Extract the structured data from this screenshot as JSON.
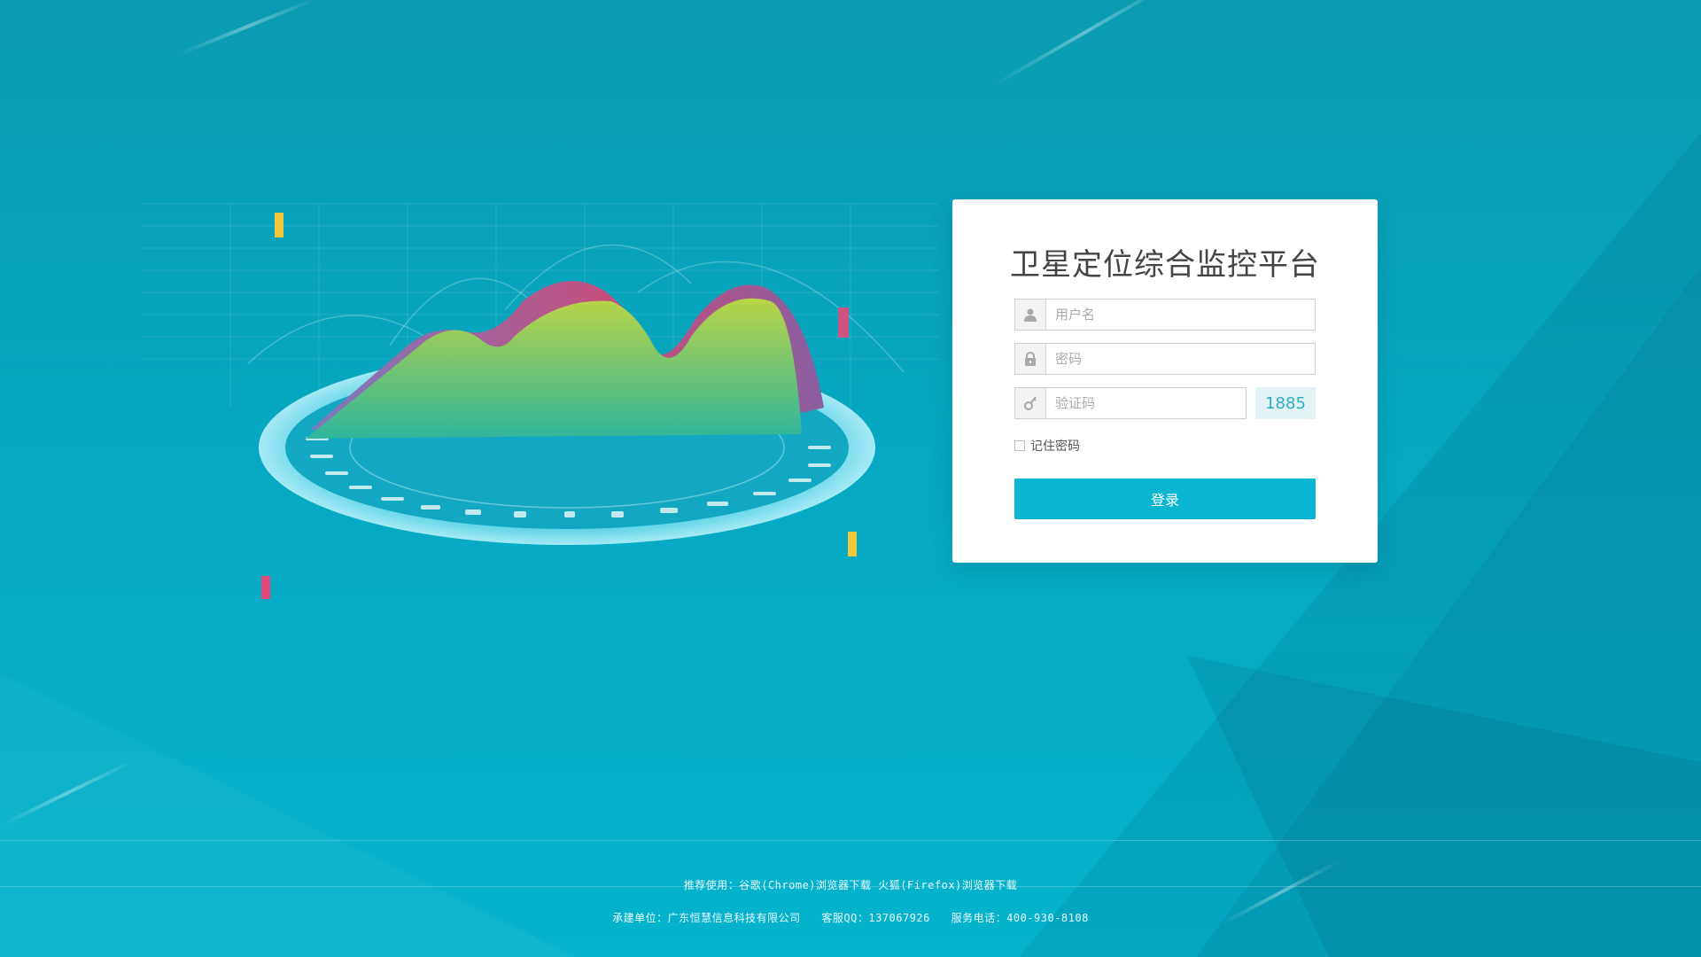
{
  "login": {
    "title": "卫星定位综合监控平台",
    "username_placeholder": "用户名",
    "password_placeholder": "密码",
    "captcha_placeholder": "验证码",
    "captcha_code": "1885",
    "remember_label": "记住密码",
    "submit_label": "登录"
  },
  "footer": {
    "browser_recommend": "推荐使用：谷歌(Chrome)浏览器下载 火狐(Firefox)浏览器下载",
    "builder": "承建单位：广东恒慧信息科技有限公司",
    "qq": "客服QQ：137067926",
    "phone": "服务电话：400-930-8108"
  },
  "colors": {
    "background": "#06a7c1",
    "accent": "#09b5d0",
    "captcha_bg": "#e4f4f6"
  },
  "icons": [
    "user-icon",
    "lock-icon",
    "key-icon"
  ]
}
